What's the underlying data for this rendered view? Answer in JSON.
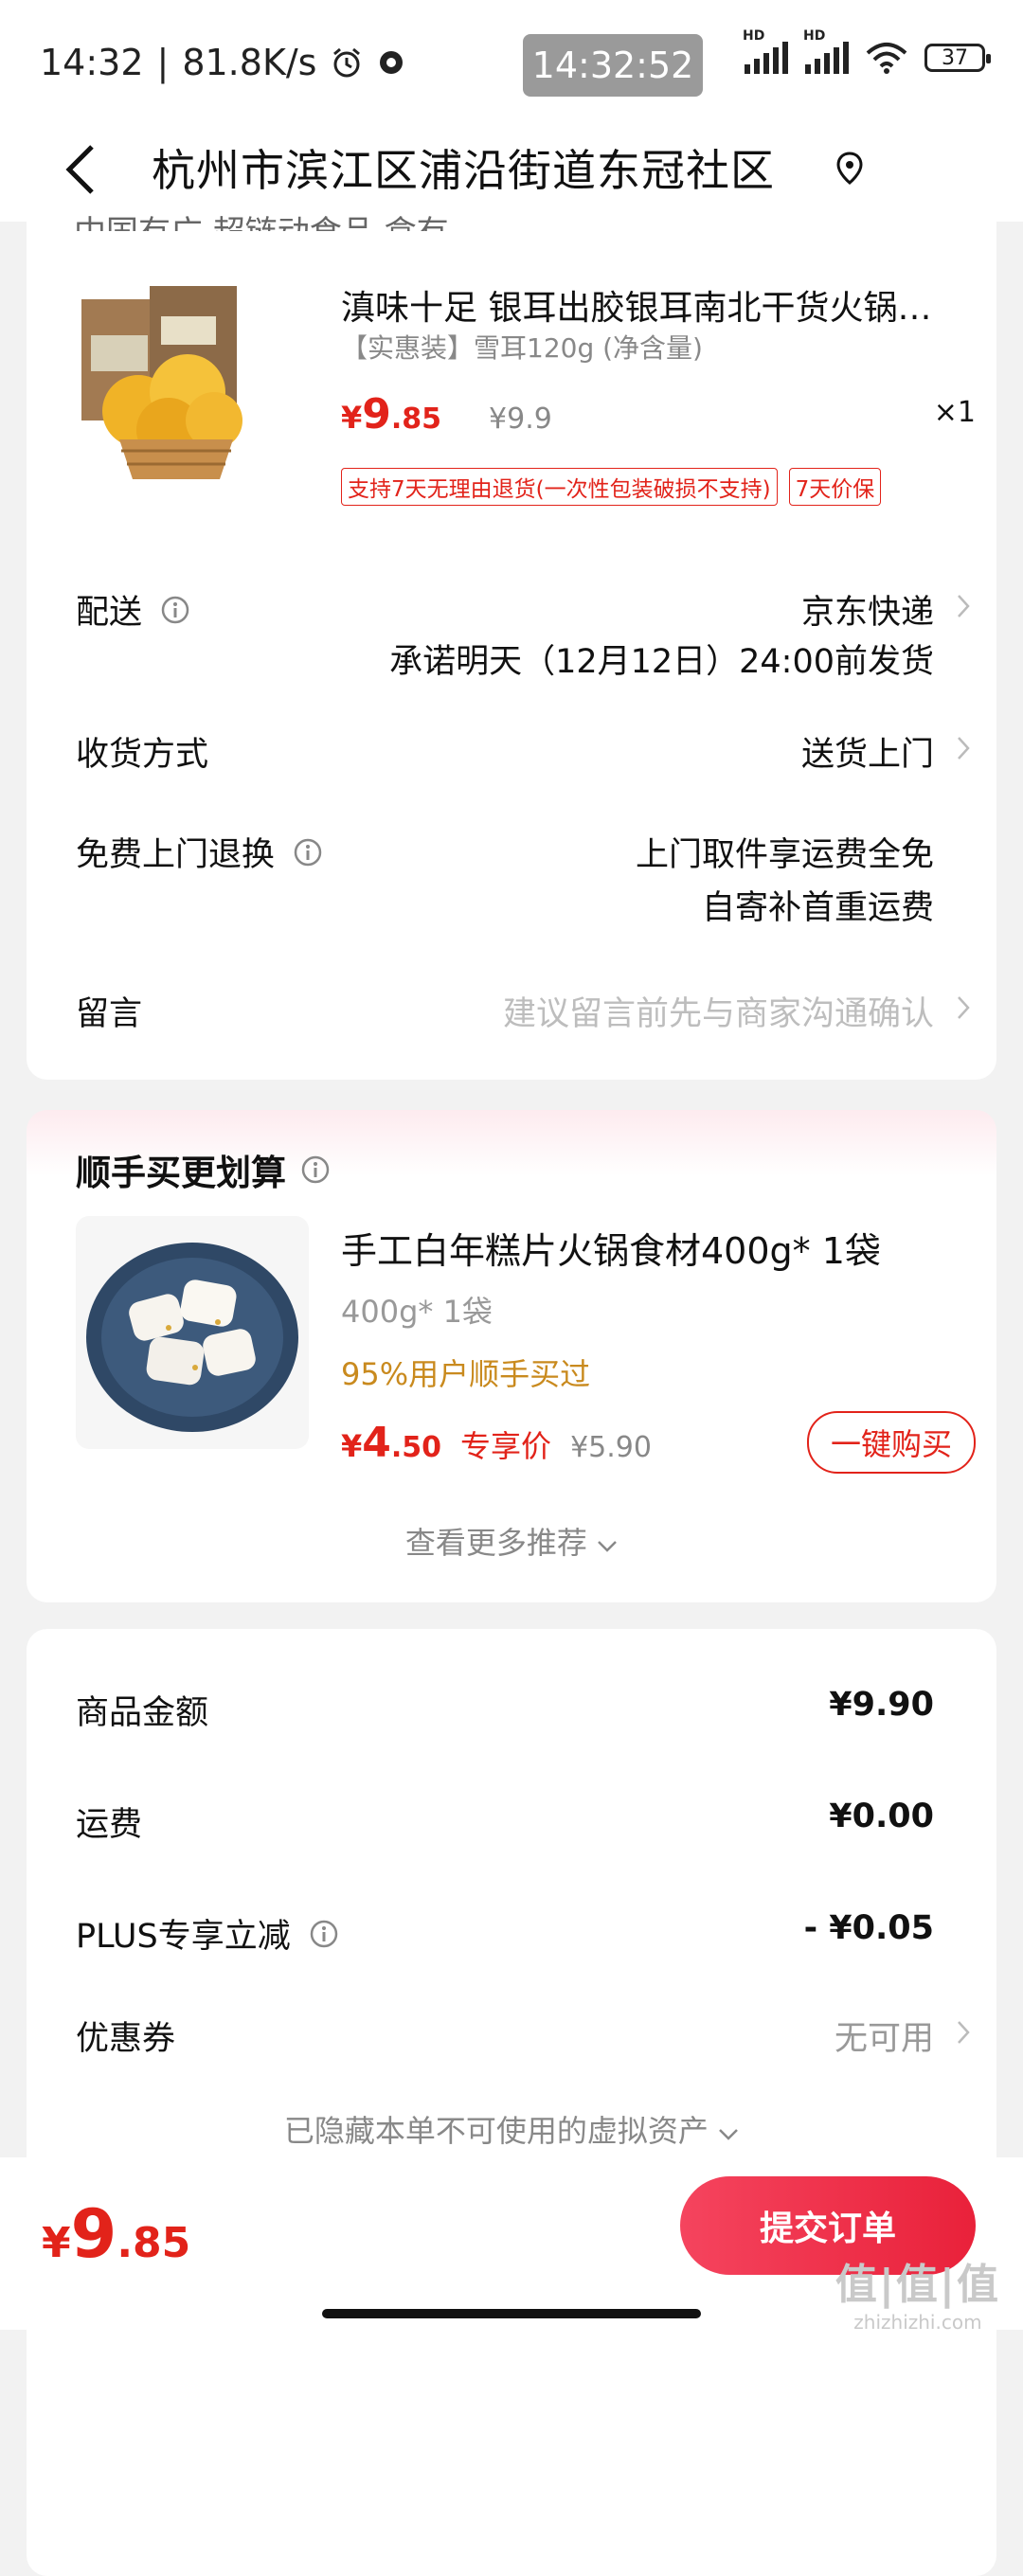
{
  "status_bar": {
    "time": "14:32",
    "net_speed": "81.8K/s",
    "center_clock": "14:32:52",
    "signal_label_1": "HD",
    "signal_label_2": "HD",
    "battery": "37"
  },
  "header": {
    "title": "杭州市滨江区浦沿街道东冠社区"
  },
  "product": {
    "partial_text": "中国有广 超链动食品 盒有",
    "title": "滇味十足 银耳出胶银耳南北干货火锅…",
    "spec": "【实惠装】雪耳120g (净含量)",
    "price_currency": "¥",
    "price_int": "9",
    "price_dec": ".85",
    "orig_price": "¥9.9",
    "qty": "×1",
    "tags": [
      "支持7天无理由退货(一次性包装破损不支持)",
      "7天价保"
    ]
  },
  "order_rows": {
    "delivery": {
      "label": "配送",
      "value": "京东快递",
      "sub": "承诺明天（12月12日）24:00前发货"
    },
    "receive": {
      "label": "收货方式",
      "value": "送货上门"
    },
    "return": {
      "label": "免费上门退换",
      "value_line1": "上门取件享运费全免",
      "value_line2": "自寄补首重运费"
    },
    "message": {
      "label": "留言",
      "placeholder": "建议留言前先与商家沟通确认"
    }
  },
  "recommend": {
    "title": "顺手买更划算",
    "item_name": "手工白年糕片火锅食材400g* 1袋",
    "item_spec": "400g* 1袋",
    "item_popularity": "95%用户顺手买过",
    "price_currency": "¥",
    "price_int": "4",
    "price_dec": ".50",
    "special_label": "专享价",
    "orig_price": "¥5.90",
    "buy_button": "一键购买",
    "more_link": "查看更多推荐"
  },
  "summary": {
    "goods_label": "商品金额",
    "goods_value": "¥9.90",
    "shipping_label": "运费",
    "shipping_value": "¥0.00",
    "plus_label": "PLUS专享立减",
    "plus_value": "- ¥0.05",
    "coupon_label": "优惠券",
    "coupon_value": "无可用",
    "hidden_note": "已隐藏本单不可使用的虚拟资产"
  },
  "bottom": {
    "total_currency": "¥",
    "total_int": "9",
    "total_dec": ".85",
    "submit_label": "提交订单",
    "watermark_logo": "值|值|值",
    "watermark_url": "zhizhizhi.com"
  },
  "colors": {
    "accent_red": "#e2231a",
    "popularity_orange": "#c98a1e",
    "background": "#f2f2f2"
  }
}
